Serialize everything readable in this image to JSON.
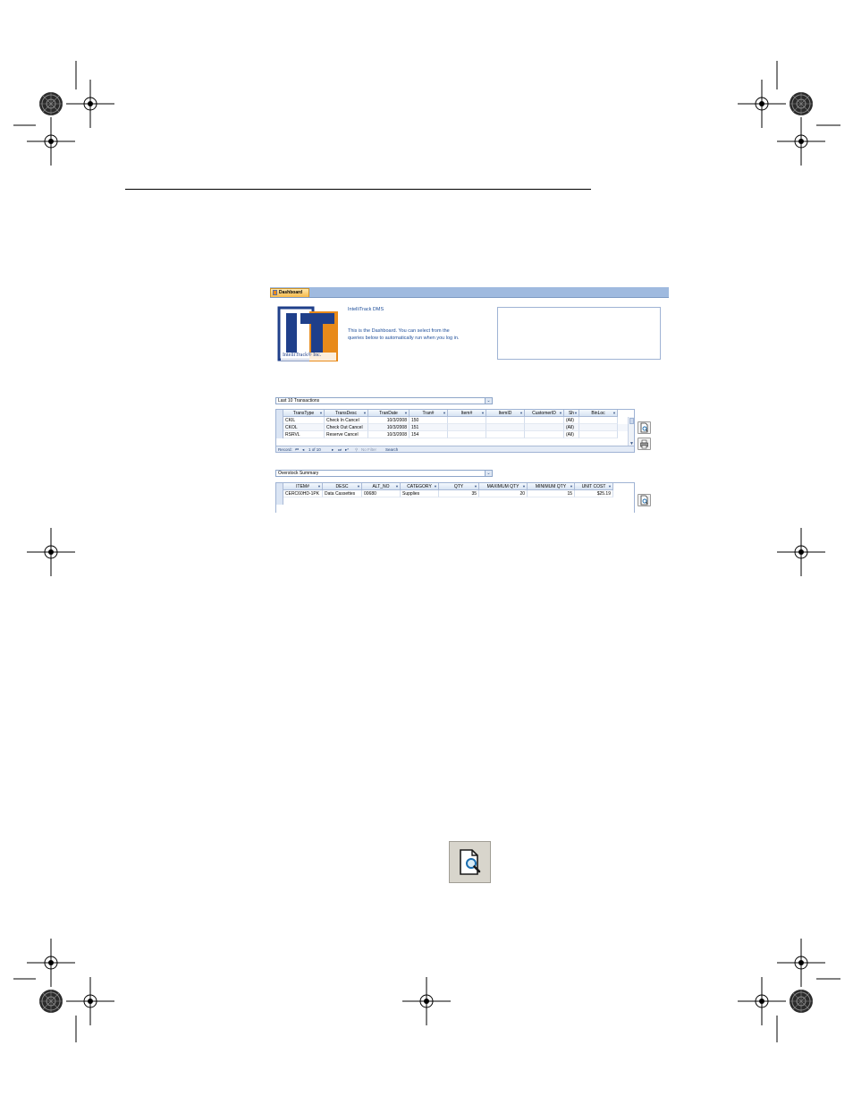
{
  "dashboard": {
    "tab_label": "Dashboard",
    "app_title": "IntelliTrack DMS",
    "description": "This is the Dashboard.  You can select from the queries below to automatically run when you log in.",
    "logo": {
      "letters": "IT",
      "caption": "IntelliTrack® Inc."
    }
  },
  "query1": {
    "selected": "Last 10 Transactions",
    "columns": [
      "TransType",
      "TransDesc",
      "TranDate",
      "Tran#",
      "Item#",
      "ItemID",
      "CustomerID",
      "Sh",
      "BinLoc"
    ],
    "rows": [
      [
        "CKIL",
        "Check In Cancel",
        "10/3/2008",
        "150",
        "",
        "",
        "",
        "(All)",
        ""
      ],
      [
        "CKOL",
        "Check Out Cancel",
        "10/3/2008",
        "151",
        "",
        "",
        "",
        "(All)",
        ""
      ],
      [
        "RSRVL",
        "Reserve Cancel",
        "10/3/2008",
        "154",
        "",
        "",
        "",
        "(All)",
        ""
      ]
    ],
    "nav": {
      "record_label": "Record:",
      "position": "1 of 10",
      "filter": "No Filter",
      "search": "Search"
    }
  },
  "query2": {
    "selected": "Overstock Summary",
    "columns": [
      "ITEM#",
      "DESC",
      "ALT_NO",
      "CATEGORY",
      "QTY",
      "MAXIMUM QTY",
      "MINIMUM QTY",
      "UNIT COST"
    ],
    "rows": [
      [
        "CERC60HD-1PK",
        "Data Cassettes",
        "00680",
        "Supplies",
        "35",
        "20",
        "15",
        "$25.19"
      ]
    ]
  },
  "icons": [
    "print-preview-icon",
    "print-icon",
    "dropdown-arrow-icon"
  ],
  "colors": {
    "tab_bar": "#9fbadf",
    "tab": "#f5b94a",
    "logo_blue": "#1f3f8a",
    "logo_orange": "#e88a1a",
    "link_text": "#1f4f9a"
  }
}
